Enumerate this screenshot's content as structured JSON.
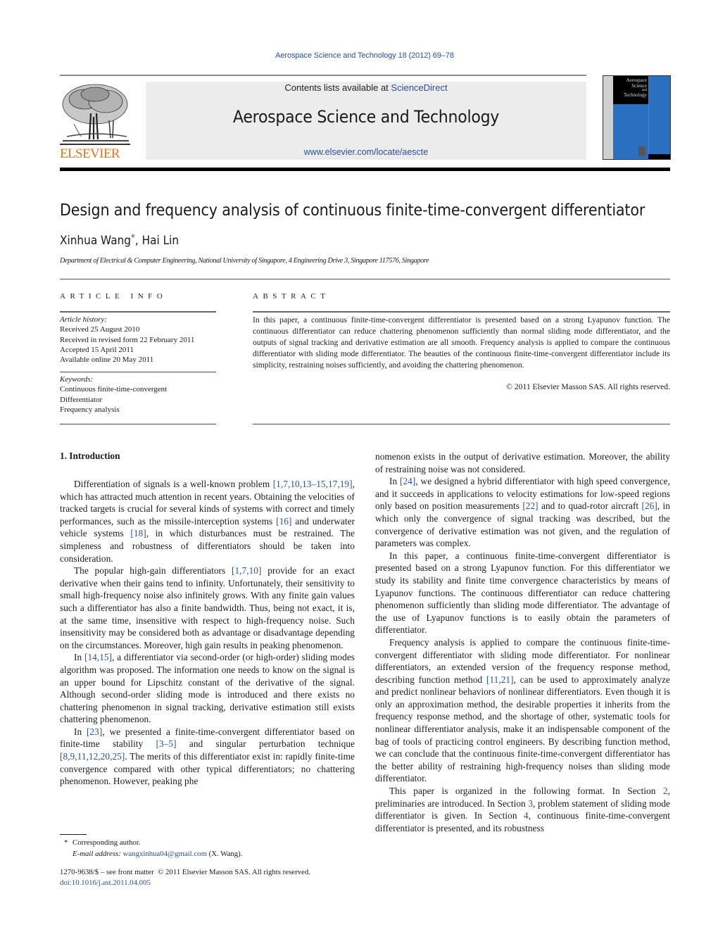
{
  "header": {
    "journal_reference": "Aerospace Science and Technology 18 (2012) 69–78",
    "contents_prefix": "Contents lists available at ",
    "contents_link": "ScienceDirect",
    "journal_title": "Aerospace Science and Technology",
    "journal_url": "www.elsevier.com/locate/aescte",
    "publisher_logo_text": "ELSEVIER",
    "cover_title_lines": [
      "Aerospace",
      "Science",
      "and",
      "Technology"
    ],
    "colors": {
      "link": "#2a4fa0",
      "elsevier_orange": "#e8731f",
      "cover_blue": "#2a6fc0"
    }
  },
  "article": {
    "title": "Design and frequency analysis of continuous finite-time-convergent differentiator",
    "authors": [
      {
        "name": "Xinhua Wang",
        "mark": "*"
      },
      {
        "name": "Hai Lin",
        "mark": ""
      }
    ],
    "author_separator": ", ",
    "affiliation": "Department of Electrical & Computer Engineering, National University of Singapore, 4 Engineering Drive 3, Singapore 117576, Singapore"
  },
  "article_info": {
    "label": "ARTICLE INFO",
    "history_label": "Article history:",
    "history": [
      "Received 25 August 2010",
      "Received in revised form 22 February 2011",
      "Accepted 15 April 2011",
      "Available online 20 May 2011"
    ],
    "keywords_label": "Keywords:",
    "keywords": [
      "Continuous finite-time-convergent",
      "Differentiator",
      "Frequency analysis"
    ]
  },
  "abstract": {
    "label": "ABSTRACT",
    "text": "In this paper, a continuous finite-time-convergent differentiator is presented based on a strong Lyapunov function. The continuous differentiator can reduce chattering phenomenon sufficiently than normal sliding mode differentiator, and the outputs of signal tracking and derivative estimation are all smooth. Frequency analysis is applied to compare the continuous differentiator with sliding mode differentiator. The beauties of the continuous finite-time-convergent differentiator include its simplicity, restraining noises sufficiently, and avoiding the chattering phenomenon.",
    "copyright": "© 2011 Elsevier Masson SAS. All rights reserved."
  },
  "body": {
    "section_heading": "1. Introduction",
    "left_paragraphs": [
      [
        {
          "t": "Differentiation of signals is a well-known problem "
        },
        {
          "t": "[1,7,10,13–15,17,19]",
          "ref": true
        },
        {
          "t": ", which has attracted much attention in recent years. Obtaining the velocities of tracked targets is crucial for several kinds of systems with correct and timely performances, such as the missile-interception systems "
        },
        {
          "t": "[16]",
          "ref": true
        },
        {
          "t": " and underwater vehicle systems "
        },
        {
          "t": "[18]",
          "ref": true
        },
        {
          "t": ", in which disturbances must be restrained. The simpleness and robustness of differentiators should be taken into consideration."
        }
      ],
      [
        {
          "t": "The popular high-gain differentiators "
        },
        {
          "t": "[1,7,10]",
          "ref": true
        },
        {
          "t": " provide for an exact derivative when their gains tend to infinity. Unfortunately, their sensitivity to small high-frequency noise also infinitely grows. With any finite gain values such a differentiator has also a finite bandwidth. Thus, being not exact, it is, at the same time, insensi­tive with respect to high-frequency noise. Such insensitivity may be considered both as advantage or disadvantage depending on the circumstances. Moreover, high gain results in peaking phe­nomenon."
        }
      ],
      [
        {
          "t": "In "
        },
        {
          "t": "[14,15]",
          "ref": true
        },
        {
          "t": ", a differentiator via second-order (or high-order) slid­ing modes algorithm was proposed. The information one needs to know on the signal is an upper bound for Lipschitz constant of the derivative of the signal. Although second-order sliding mode is introduced and there exists no chattering phenomenon in signal tracking, derivative estimation still exists chattering phenomenon."
        }
      ],
      [
        {
          "t": "In "
        },
        {
          "t": "[23]",
          "ref": true
        },
        {
          "t": ", we presented a finite-time-convergent differentiator based on finite-time stability "
        },
        {
          "t": "[3–5]",
          "ref": true
        },
        {
          "t": " and singular perturbation tech­nique "
        },
        {
          "t": "[8,9,11,12,20,25]",
          "ref": true
        },
        {
          "t": ". The merits of this differentiator exist in: rapidly finite-time convergence compared with other typical dif­ferentiators; no chattering phenomenon. However, peaking phe­"
        }
      ]
    ],
    "right_paragraphs": [
      [
        {
          "t": "nomenon exists in the output of derivative estimation. Moreover, the ability of restraining noise was not considered."
        }
      ],
      [
        {
          "t": "In "
        },
        {
          "t": "[24]",
          "ref": true
        },
        {
          "t": ", we designed a hybrid differentiator with high speed convergence, and it succeeds in applications to velocity estimations for low-speed regions only based on position measurements "
        },
        {
          "t": "[22]",
          "ref": true
        },
        {
          "t": " and to quad-rotor aircraft "
        },
        {
          "t": "[26]",
          "ref": true
        },
        {
          "t": ", in which only the convergence of signal tracking was described, but the convergence of derivative estimation was not given, and the regulation of parameters was complex."
        }
      ],
      [
        {
          "t": "In this paper, a continuous finite-time-convergent differentia­tor is presented based on a strong Lyapunov function. For this differentiator we study its stability and finite time convergence characteristics by means of Lyapunov functions. The continuous differentiator can reduce chattering phenomenon sufficiently than sliding mode differentiator. The advantage of the use of Lyapunov functions is to easily obtain the parameters of differentiator."
        }
      ],
      [
        {
          "t": "Frequency analysis is applied to compare the continuous finite-time-convergent differentiator with sliding mode differentiator. For nonlinear differentiators, an extended version of the frequency re­sponse method, describing function method "
        },
        {
          "t": "[11,21]",
          "ref": true
        },
        {
          "t": ", can be used to approximately analyze and predict nonlinear behaviors of non­linear differentiators. Even though it is only an approximation method, the desirable properties it inherits from the frequency response method, and the shortage of other, systematic tools for nonlinear differentiator analysis, make it an indispensable compo­nent of the bag of tools of practicing control engineers. By de­scribing function method, we can conclude that the continuous finite-time-convergent differentiator has the better ability of re­straining high-frequency noises than sliding mode differentiator."
        }
      ],
      [
        {
          "t": "This paper is organized in the following format. In Section "
        },
        {
          "t": "2",
          "ref": true
        },
        {
          "t": ", preliminaries are introduced. In Section "
        },
        {
          "t": "3",
          "ref": true
        },
        {
          "t": ", problem statement of sliding mode differentiator is given. In Section "
        },
        {
          "t": "4",
          "ref": true
        },
        {
          "t": ", continuous finite-time-convergent differentiator is presented, and its robustness"
        }
      ]
    ]
  },
  "footnotes": {
    "star": "*",
    "corresponding": "Corresponding author.",
    "email_label": "E-mail address:",
    "email": "wangxinhua04@gmail.com",
    "email_suffix": " (X. Wang).",
    "front_matter": "1270-9638/$ – see front matter  © 2011 Elsevier Masson SAS. All rights reserved.",
    "doi": "doi:10.1016/j.ast.2011.04.005"
  }
}
